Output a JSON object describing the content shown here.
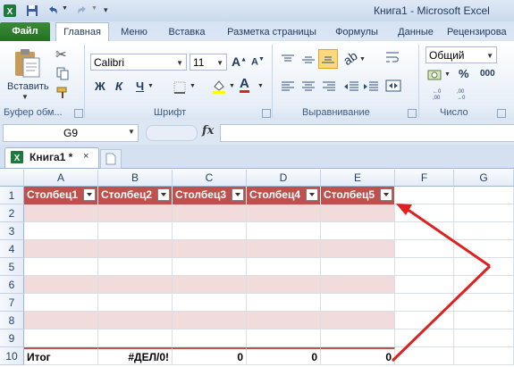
{
  "window": {
    "title": "Книга1  -  Microsoft Excel"
  },
  "ribbon_tabs": [
    "Файл",
    "Главная",
    "Меню",
    "Вставка",
    "Разметка страницы",
    "Формулы",
    "Данные",
    "Рецензирова"
  ],
  "ribbon": {
    "paste_label": "Вставить",
    "clipboard_group": "Буфер обм...",
    "font_name": "Calibri",
    "font_size": "11",
    "font_group": "Шрифт",
    "bold": "Ж",
    "italic": "К",
    "underline": "Ч",
    "alignment_group": "Выравнивание",
    "number_format": "Общий",
    "number_group": "Число",
    "percent": "%",
    "thousands": "000"
  },
  "formula_bar": {
    "name_box": "G9",
    "fx": "fx",
    "content": ""
  },
  "workbook_tab": {
    "label": "Книга1 *",
    "close": "×"
  },
  "columns": [
    "A",
    "B",
    "C",
    "D",
    "E",
    "F",
    "G"
  ],
  "rows": [
    "1",
    "2",
    "3",
    "4",
    "5",
    "6",
    "7",
    "8",
    "9",
    "10"
  ],
  "table": {
    "headers": [
      "Столбец1",
      "Столбец2",
      "Столбец3",
      "Столбец4",
      "Столбец5"
    ],
    "total_row": [
      "Итог",
      "#ДЕЛ/0!",
      "0",
      "0",
      "0"
    ],
    "header_color": "#c0504d",
    "band_color": "#f2dcdb"
  },
  "annotation": {
    "color": "#e02020",
    "shape": "red-arrow-pointer"
  }
}
